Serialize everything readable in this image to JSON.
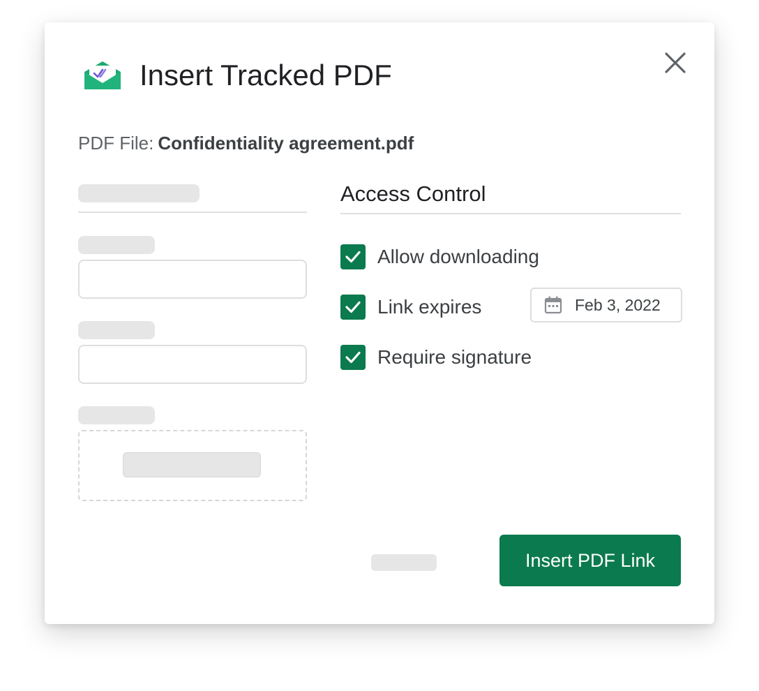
{
  "dialog": {
    "title": "Insert Tracked PDF",
    "logo_icon": "envelope-checkmark-icon",
    "close_icon": "close-icon"
  },
  "file": {
    "label": "PDF File:",
    "name": "Confidentiality agreement.pdf"
  },
  "access_control": {
    "title": "Access Control",
    "options": [
      {
        "label": "Allow downloading",
        "checked": true
      },
      {
        "label": "Link expires",
        "checked": true
      },
      {
        "label": "Require signature",
        "checked": true
      }
    ],
    "expiry_date": "Feb 3, 2022",
    "calendar_icon": "calendar-icon"
  },
  "footer": {
    "insert_label": "Insert PDF Link"
  },
  "colors": {
    "accent": "#0b7a4e",
    "logo_green": "#21b37c",
    "logo_purple": "#6a56d8",
    "skeleton": "#e6e6e6"
  }
}
